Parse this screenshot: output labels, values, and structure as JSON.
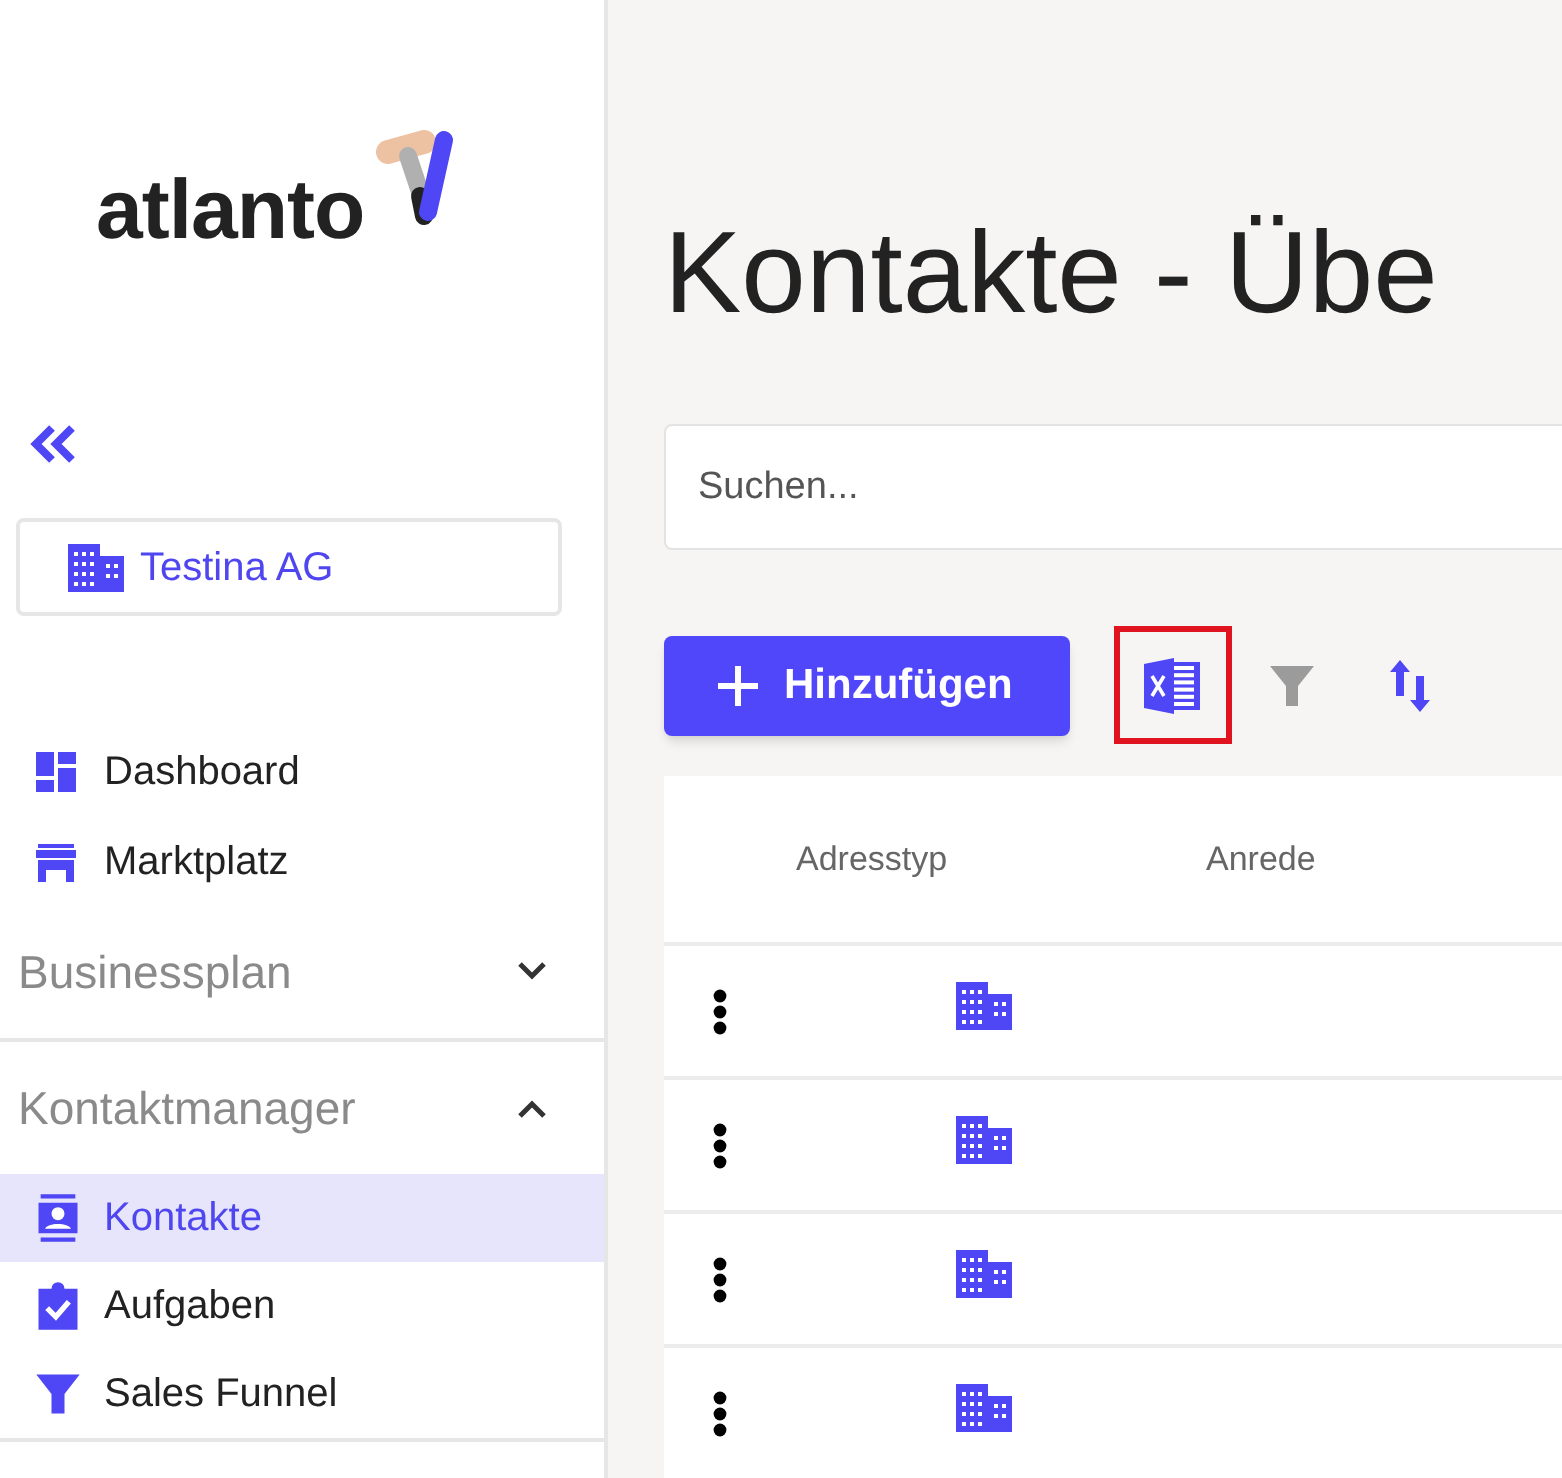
{
  "sidebar": {
    "logo": "atlanto",
    "company": "Testina AG",
    "nav": [
      {
        "label": "Dashboard",
        "selected": false
      },
      {
        "label": "Marktplatz",
        "selected": false
      }
    ],
    "sections": [
      {
        "title": "Businessplan",
        "expanded": false
      },
      {
        "title": "Kontaktmanager",
        "expanded": true,
        "items": [
          {
            "label": "Kontakte",
            "selected": true
          },
          {
            "label": "Aufgaben",
            "selected": false
          },
          {
            "label": "Sales Funnel",
            "selected": false
          }
        ]
      }
    ]
  },
  "main": {
    "title": "Kontakte - Übe",
    "search": {
      "placeholder": "Suchen..."
    },
    "add_button": "Hinzufügen",
    "tools": [
      {
        "kind": "excel",
        "highlighted": true,
        "disabled": false
      },
      {
        "kind": "filter",
        "highlighted": false,
        "disabled": true
      },
      {
        "kind": "sort",
        "highlighted": false,
        "disabled": false
      }
    ],
    "table": {
      "columns": [
        "Adresstyp",
        "Anrede"
      ],
      "rows": [
        {
          "kind": "company"
        },
        {
          "kind": "company"
        },
        {
          "kind": "company"
        },
        {
          "kind": "company"
        }
      ]
    }
  }
}
